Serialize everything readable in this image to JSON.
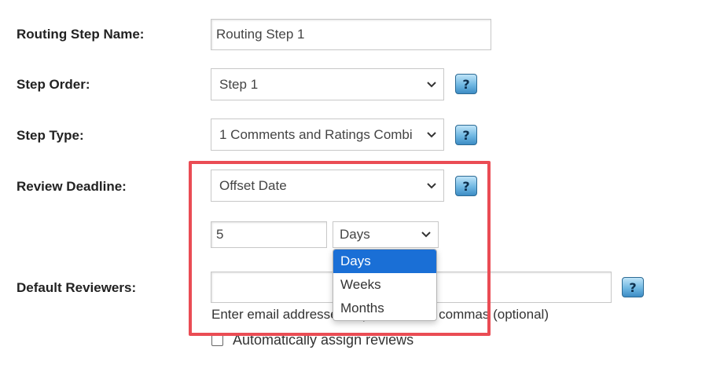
{
  "labels": {
    "routing_step_name": "Routing Step Name:",
    "step_order": "Step Order:",
    "step_type": "Step Type:",
    "review_deadline": "Review Deadline:",
    "default_reviewers": "Default Reviewers:"
  },
  "fields": {
    "routing_step_name": "Routing Step 1",
    "step_order": "Step 1",
    "step_type": "1 Comments and Ratings Combi",
    "review_deadline": "Offset Date",
    "offset_amount": "5",
    "offset_unit": "Days",
    "default_reviewers": ""
  },
  "help_button_label": "?",
  "offset_unit_options": [
    {
      "label": "Days",
      "selected": true
    },
    {
      "label": "Weeks",
      "selected": false
    },
    {
      "label": "Months",
      "selected": false
    }
  ],
  "reviewers_help_text": "Enter email addresses separated with commas (optional)",
  "auto_assign_label": "Automatically assign reviews",
  "colors": {
    "highlight_border": "#ea4c54",
    "option_selected_bg": "#1a6fd6",
    "help_button": "#6fb7e2"
  },
  "icons": {
    "select_arrow": "chevron-down-icon",
    "help": "question-mark-icon"
  }
}
